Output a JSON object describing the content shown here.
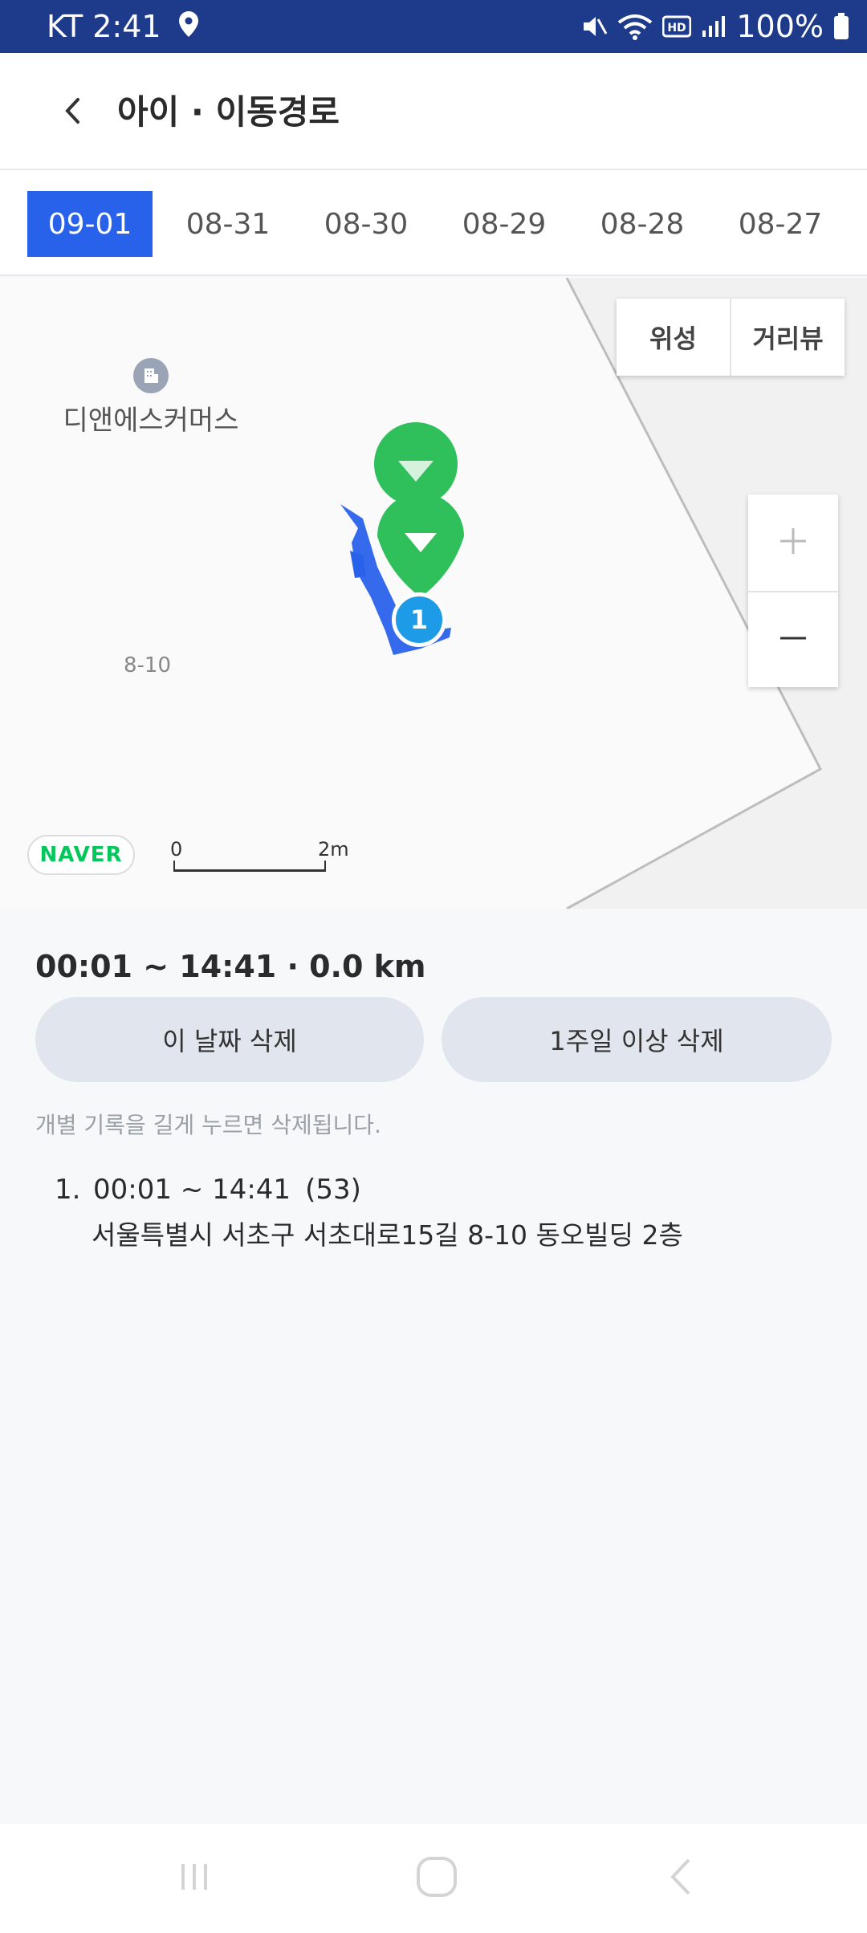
{
  "status_bar": {
    "carrier_time": "KT 2:41",
    "battery": "100%",
    "icons": [
      "location-icon",
      "mute-icon",
      "wifi-icon",
      "hd-icon",
      "signal-icon",
      "battery-icon"
    ]
  },
  "header": {
    "title": "아이 · 이동경로",
    "back_icon": "back-chevron-icon"
  },
  "tabs": [
    {
      "label": "09-01",
      "active": true
    },
    {
      "label": "08-31",
      "active": false
    },
    {
      "label": "08-30",
      "active": false
    },
    {
      "label": "08-29",
      "active": false
    },
    {
      "label": "08-28",
      "active": false
    },
    {
      "label": "08-27",
      "active": false
    }
  ],
  "map": {
    "satellite_label": "위성",
    "streetview_label": "거리뷰",
    "poi_label": "디앤에스커머스",
    "address_label": "8-10",
    "naver_logo": "NAVER",
    "scale_zero": "0",
    "scale_max": "2m",
    "marker_number": "1",
    "route_color": "#2962ea",
    "marker_color": "#2fbf5b",
    "point_color": "#1e9be6"
  },
  "summary": {
    "text": "00:01 ~ 14:41 · 0.0 km",
    "delete_day": "이 날짜 삭제",
    "delete_week": "1주일 이상 삭제",
    "hint": "개별 기록을 길게 누르면 삭제됩니다."
  },
  "records": [
    {
      "index": "1.",
      "time": "00:01 ~ 14:41",
      "count": "(53)",
      "address": "서울특별시 서초구 서초대로15길 8-10 동오빌딩 2층"
    }
  ]
}
